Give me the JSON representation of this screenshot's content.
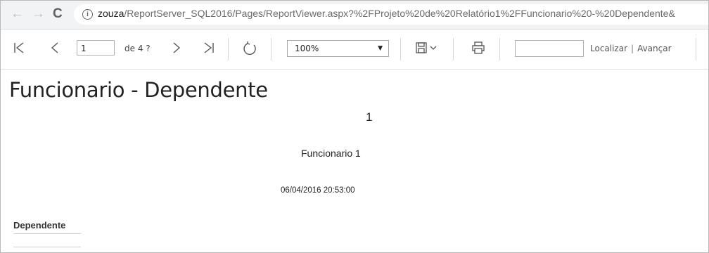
{
  "browser": {
    "back_icon": "arrow-left-icon",
    "forward_icon": "arrow-right-icon",
    "reload_icon": "reload-icon",
    "url_host": "zouza",
    "url_path": "/ReportServer_SQL2016/Pages/ReportViewer.aspx?%2FProjeto%20de%20Relatório1%2FFuncionario%20-%20Dependente&"
  },
  "toolbar": {
    "current_page": "1",
    "page_of": "de 4 ?",
    "zoom": "100%",
    "find_value": "",
    "find_label": "Localizar",
    "separator": "|",
    "next_label": "Avançar"
  },
  "report": {
    "title": "Funcionario - Dependente",
    "employee_id": "1",
    "employee_name": "Funcionario 1",
    "date": "06/04/2016 20:53:00",
    "dependent_header": "Dependente"
  }
}
